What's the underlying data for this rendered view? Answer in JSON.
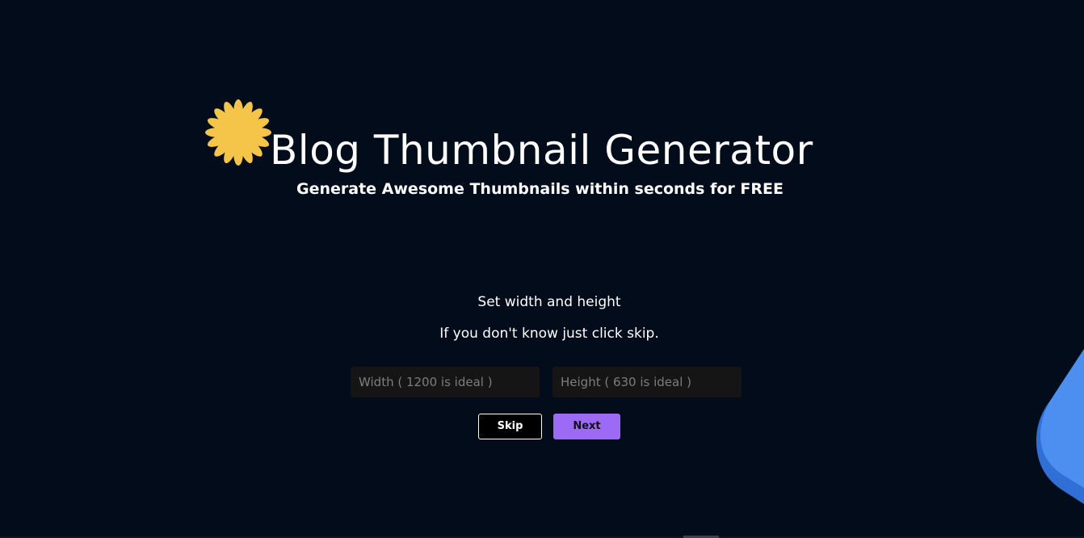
{
  "header": {
    "title": "Blog Thumbnail Generator",
    "subtitle": "Generate Awesome Thumbnails within seconds for FREE",
    "logo_icon": "sun-flower-icon"
  },
  "setup": {
    "heading": "Set width and height",
    "hint": "If you don't know just click skip.",
    "width_field": {
      "value": "",
      "placeholder": "Width ( 1200 is ideal )"
    },
    "height_field": {
      "value": "",
      "placeholder": "Height ( 630 is ideal )"
    },
    "skip_label": "Skip",
    "next_label": "Next"
  },
  "colors": {
    "background": "#020c1b",
    "accent": "#9c6af4",
    "logo": "#f5c54a",
    "blob": "#4d8ff0"
  }
}
